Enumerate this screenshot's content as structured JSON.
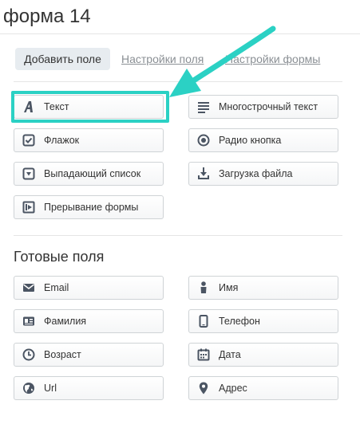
{
  "page": {
    "title": "форма 14"
  },
  "tabs": {
    "add_field": "Добавить поле",
    "field_settings": "Настройки поля",
    "form_settings": "Настройки формы"
  },
  "fields": {
    "text": "Текст",
    "multiline": "Многострочный текст",
    "checkbox": "Флажок",
    "radio": "Радио кнопка",
    "dropdown": "Выпадающий список",
    "file_upload": "Загрузка файла",
    "page_break": "Прерывание формы"
  },
  "ready_fields": {
    "title": "Готовые поля",
    "email": "Email",
    "name": "Имя",
    "surname": "Фамилия",
    "phone": "Телефон",
    "age": "Возраст",
    "date": "Дата",
    "url": "Url",
    "address": "Адрес"
  },
  "colors": {
    "accent_highlight": "#2bd1c4",
    "icon": "#4b5563"
  },
  "icons": {
    "text": "letter-a-icon",
    "multiline": "lines-icon",
    "checkbox": "checkbox-icon",
    "radio": "radio-icon",
    "dropdown": "dropdown-icon",
    "file_upload": "download-icon",
    "page_break": "page-break-icon",
    "email": "envelope-icon",
    "name": "person-icon",
    "surname": "id-card-icon",
    "phone": "phone-icon",
    "age": "clock-icon",
    "date": "calendar-icon",
    "url": "globe-icon",
    "address": "map-pin-icon"
  }
}
